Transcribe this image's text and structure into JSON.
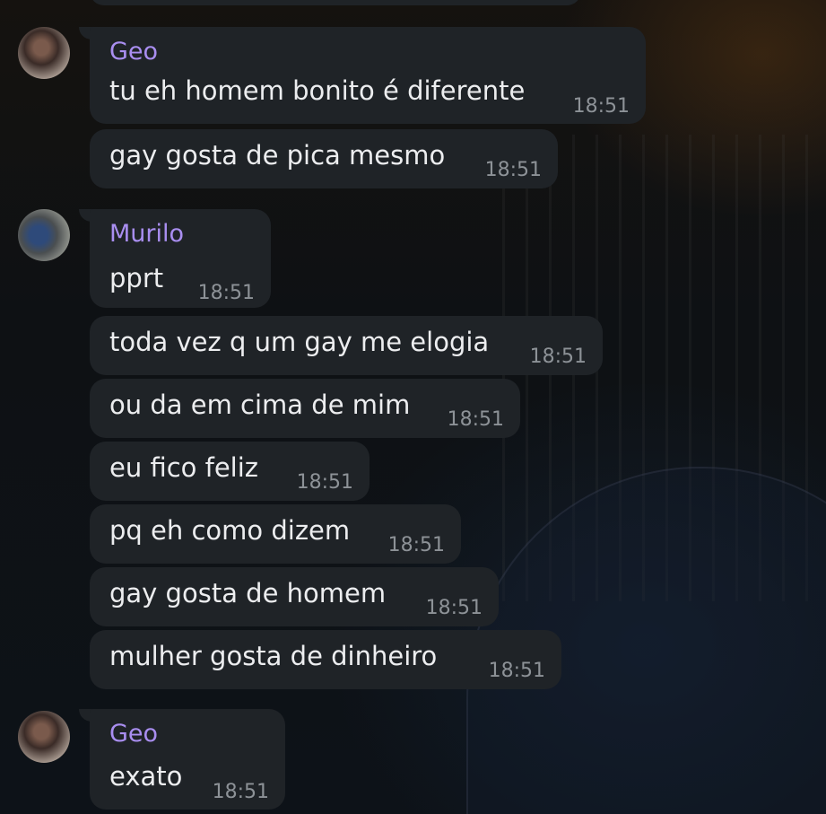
{
  "messages": [
    {
      "sender": "Geo",
      "text": "tu eh homem bonito é diferente",
      "time": "18:51"
    },
    {
      "sender": "Geo",
      "text": "gay gosta de pica mesmo",
      "time": "18:51"
    },
    {
      "sender": "Murilo",
      "text": "pprt",
      "time": "18:51"
    },
    {
      "sender": "Murilo",
      "text": "toda vez q um gay me elogia",
      "time": "18:51"
    },
    {
      "sender": "Murilo",
      "text": "ou da em cima de mim",
      "time": "18:51"
    },
    {
      "sender": "Murilo",
      "text": "eu fico feliz",
      "time": "18:51"
    },
    {
      "sender": "Murilo",
      "text": "pq eh como dizem",
      "time": "18:51"
    },
    {
      "sender": "Murilo",
      "text": "gay gosta de homem",
      "time": "18:51"
    },
    {
      "sender": "Murilo",
      "text": "mulher gosta de dinheiro",
      "time": "18:51"
    },
    {
      "sender": "Geo",
      "text": "exato",
      "time": "18:51"
    }
  ],
  "colors": {
    "bubble": "#1f2327",
    "name": "#a98ef0",
    "text": "#ecedef",
    "time": "#8d9297"
  }
}
